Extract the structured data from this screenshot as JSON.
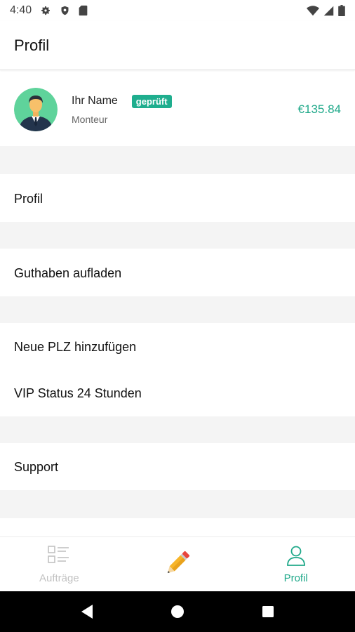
{
  "status_bar": {
    "time": "4:40"
  },
  "app_bar": {
    "title": "Profil"
  },
  "profile": {
    "name": "Ihr Name",
    "badge": "geprüft",
    "role": "Monteur",
    "balance": "€135.84"
  },
  "menu": {
    "profile": "Profil",
    "topup": "Guthaben aufladen",
    "add_zip": "Neue PLZ hinzufügen",
    "vip": "VIP Status 24 Stunden",
    "support": "Support"
  },
  "bottom_nav": {
    "orders": "Aufträge",
    "profile": "Profil"
  },
  "colors": {
    "accent": "#20a98a",
    "badge_bg": "#1fae8e",
    "separator": "#f4f4f4"
  },
  "icons": {
    "status": [
      "settings-icon",
      "shield-icon",
      "sd-card-icon",
      "wifi-icon",
      "signal-icon",
      "battery-icon"
    ],
    "nav": [
      "list-icon",
      "pencil-icon",
      "person-icon"
    ],
    "system": [
      "back-icon",
      "home-icon",
      "recents-icon"
    ]
  }
}
